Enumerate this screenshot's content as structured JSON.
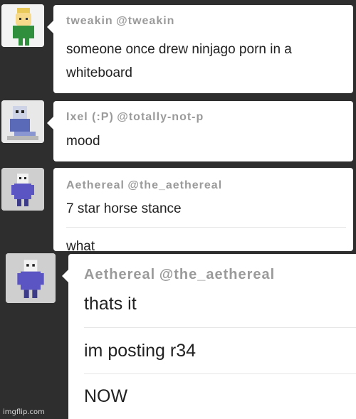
{
  "messages": [
    {
      "username": "tweakin",
      "handle": "@tweakin",
      "avatar_icon": "lego-ninja-avatar-icon",
      "lines": [
        "someone once drew ninjago porn in a",
        "whiteboard"
      ]
    },
    {
      "username": "Ixel (:P)",
      "handle": "@totally-not-p",
      "avatar_icon": "pixel-character-avatar-icon",
      "lines": [
        "mood"
      ]
    },
    {
      "username": "Aethereal",
      "handle": "@the_aethereal",
      "avatar_icon": "pixel-sans-avatar-icon",
      "lines": [
        "7 star horse stance",
        "what"
      ]
    },
    {
      "username": "Aethereal",
      "handle": "@the_aethereal",
      "avatar_icon": "pixel-sans-avatar-icon",
      "lines": [
        "thats it",
        "im posting r34",
        "NOW"
      ]
    }
  ],
  "watermark": "imgflip.com",
  "colors": {
    "background": "#2e2e2e",
    "card": "#ffffff",
    "username": "#9a9a9a",
    "message": "#222222"
  }
}
